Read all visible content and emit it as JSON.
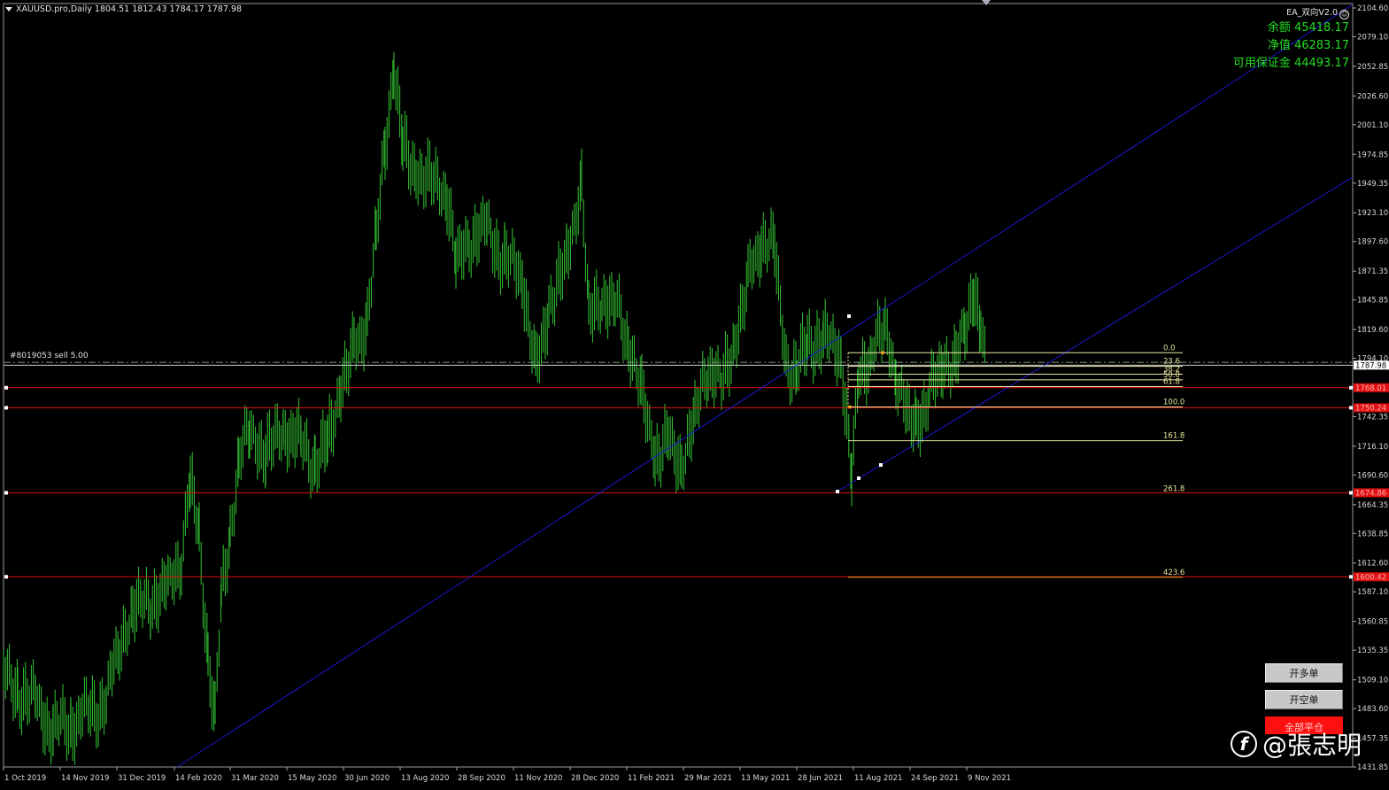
{
  "chart": {
    "title": "XAUUSD.pro,Daily  1804.51 1812.43 1784.17 1787.98",
    "price_axis": [
      "2104.60",
      "2079.10",
      "2052.85",
      "2026.60",
      "2001.10",
      "1974.85",
      "1949.35",
      "1923.10",
      "1897.60",
      "1871.35",
      "1845.85",
      "1819.60",
      "1794.10",
      "1768.60",
      "1742.35",
      "1716.10",
      "1690.60",
      "1664.35",
      "1638.85",
      "1612.60",
      "1587.10",
      "1560.85",
      "1535.35",
      "1509.10",
      "1483.60",
      "1457.35",
      "1431.85"
    ],
    "time_axis": [
      "1 Oct 2019",
      "14 Nov 2019",
      "31 Dec 2019",
      "14 Feb 2020",
      "31 Mar 2020",
      "15 May 2020",
      "30 Jun 2020",
      "13 Aug 2020",
      "28 Sep 2020",
      "11 Nov 2020",
      "28 Dec 2020",
      "11 Feb 2021",
      "29 Mar 2021",
      "13 May 2021",
      "28 Jun 2021",
      "11 Aug 2021",
      "24 Sep 2021",
      "9 Nov 2021"
    ],
    "current_price": "1787.98",
    "price_tags": [
      "1768.01",
      "1750.24",
      "1674.86",
      "1600.42"
    ],
    "fib_levels": [
      "0.0",
      "23.6",
      "38.2",
      "50.0",
      "61.8",
      "100.0",
      "161.8",
      "261.8",
      "423.6"
    ],
    "order_label": "#8019053 sell 5.00",
    "colors": {
      "candle": "#33c633",
      "channel": "#1a1acc",
      "level": "#e01010",
      "fib": "#e8e8a0",
      "order": "#7d9a7d"
    }
  },
  "ea_panel": {
    "name": "EA_双向V2.0",
    "balance": "余额 45418.17",
    "equity": "净值 46283.17",
    "free_margin": "可用保证金 44493.17"
  },
  "buttons": {
    "buy": "开多单",
    "sell": "开空单",
    "close_all": "全部平仓"
  },
  "watermark": {
    "text": "@張志明",
    "icon": "feather-logo-icon"
  }
}
